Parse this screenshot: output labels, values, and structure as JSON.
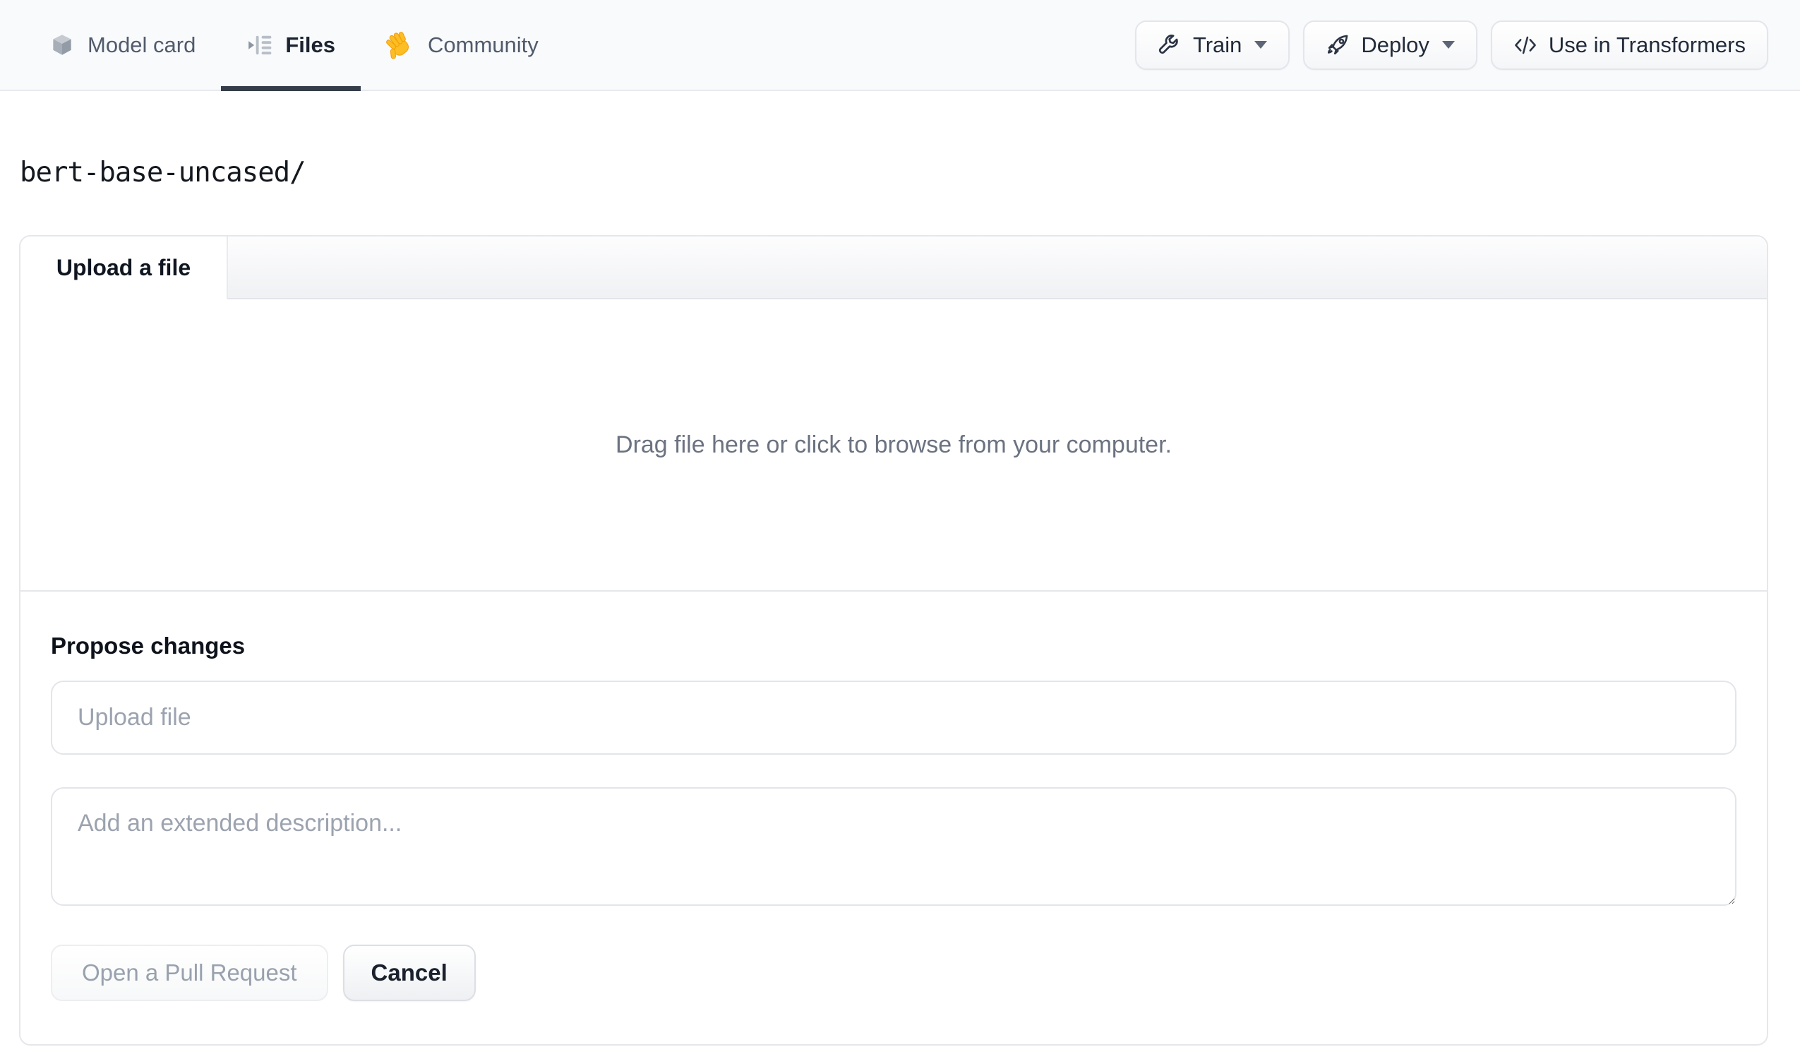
{
  "nav": {
    "tabs": [
      {
        "label": "Model card",
        "icon": "cube-icon",
        "active": false
      },
      {
        "label": "Files",
        "icon": "files-list-icon",
        "active": true
      },
      {
        "label": "Community",
        "icon": "waving-hand-icon",
        "active": false
      }
    ],
    "actions": [
      {
        "label": "Train",
        "icon": "wrench-icon",
        "dropdown": true
      },
      {
        "label": "Deploy",
        "icon": "rocket-icon",
        "dropdown": true
      },
      {
        "label": "Use in Transformers",
        "icon": "code-icon",
        "dropdown": false
      }
    ]
  },
  "repo": {
    "path": "bert-base-uncased/"
  },
  "upload_panel": {
    "tab_label": "Upload a file",
    "dropzone_text": "Drag file here or click to browse from your computer.",
    "propose_changes": {
      "heading": "Propose changes",
      "file_input": {
        "value": "",
        "placeholder": "Upload file"
      },
      "description": {
        "value": "",
        "placeholder": "Add an extended description..."
      },
      "submit_label": "Open a Pull Request",
      "cancel_label": "Cancel"
    }
  },
  "colors": {
    "nav_background": "#f8fafc",
    "active_tab_underline": "#353d4b",
    "panel_border": "#e5e7eb",
    "muted_text": "#6b7280",
    "placeholder_text": "#9ca3af",
    "dark_text": "#1f2937",
    "disabled_button_text": "#98a1ad",
    "hand_emoji_yellow": "#fbbf24"
  }
}
